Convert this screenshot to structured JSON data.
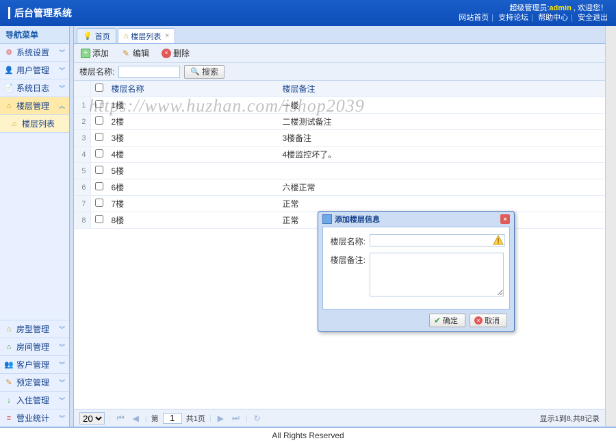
{
  "header": {
    "title": "后台管理系统",
    "welcome_prefix": "超级管理员:",
    "welcome_user": "admin",
    "welcome_suffix": " , 欢迎您！",
    "links": [
      "网站首页",
      "支持论坛",
      "帮助中心",
      "安全退出"
    ]
  },
  "sidebar": {
    "nav_title": "导航菜单",
    "top": [
      {
        "label": "系统设置",
        "icon": "⚙",
        "color": "#d9534f"
      },
      {
        "label": "用户管理",
        "icon": "👤",
        "color": "#337ab7"
      },
      {
        "label": "系统日志",
        "icon": "📄",
        "color": "#888"
      }
    ],
    "active": {
      "label": "楼层管理",
      "icon": "⌂",
      "color": "#c09820"
    },
    "sub": {
      "label": "楼层列表",
      "icon": "⌂",
      "color": "#c09820"
    },
    "bottom": [
      {
        "label": "房型管理",
        "icon": "⌂",
        "color": "#c09820"
      },
      {
        "label": "房间管理",
        "icon": "⌂",
        "color": "#3aa03a"
      },
      {
        "label": "客户管理",
        "icon": "👥",
        "color": "#5a8fd4"
      },
      {
        "label": "预定管理",
        "icon": "✎",
        "color": "#d98a1f"
      },
      {
        "label": "入住管理",
        "icon": "↓",
        "color": "#3aa03a"
      },
      {
        "label": "营业统计",
        "icon": "≡",
        "color": "#d9534f"
      }
    ]
  },
  "tabs": [
    {
      "label": "首页",
      "icon": "💡",
      "closable": false
    },
    {
      "label": "楼层列表",
      "icon": "⌂",
      "closable": true,
      "active": true
    }
  ],
  "toolbar": {
    "add": "添加",
    "edit": "编辑",
    "delete": "删除"
  },
  "search": {
    "label": "楼层名称:",
    "value": "",
    "button": "搜索"
  },
  "columns": {
    "name": "楼层名称",
    "remark": "楼层备注"
  },
  "rows": [
    {
      "idx": "1",
      "name": "1楼",
      "remark": "一楼"
    },
    {
      "idx": "2",
      "name": "2楼",
      "remark": "二楼测试备注"
    },
    {
      "idx": "3",
      "name": "3楼",
      "remark": "3楼备注"
    },
    {
      "idx": "4",
      "name": "4楼",
      "remark": "4楼监控坏了。"
    },
    {
      "idx": "5",
      "name": "5楼",
      "remark": ""
    },
    {
      "idx": "6",
      "name": "6楼",
      "remark": "六楼正常"
    },
    {
      "idx": "7",
      "name": "7楼",
      "remark": "正常"
    },
    {
      "idx": "8",
      "name": "8楼",
      "remark": "正常"
    }
  ],
  "pager": {
    "page_size": "20",
    "page_label_pre": "第",
    "page_value": "1",
    "page_label_post": "共1页",
    "info": "显示1到8,共8记录"
  },
  "dialog": {
    "title": "添加楼层信息",
    "name_label": "楼层名称:",
    "name_value": "",
    "remark_label": "楼层备注:",
    "remark_value": "",
    "ok": "确定",
    "cancel": "取消"
  },
  "footer": "All Rights Reserved",
  "watermark": "https://www.huzhan.com/ishop2039"
}
